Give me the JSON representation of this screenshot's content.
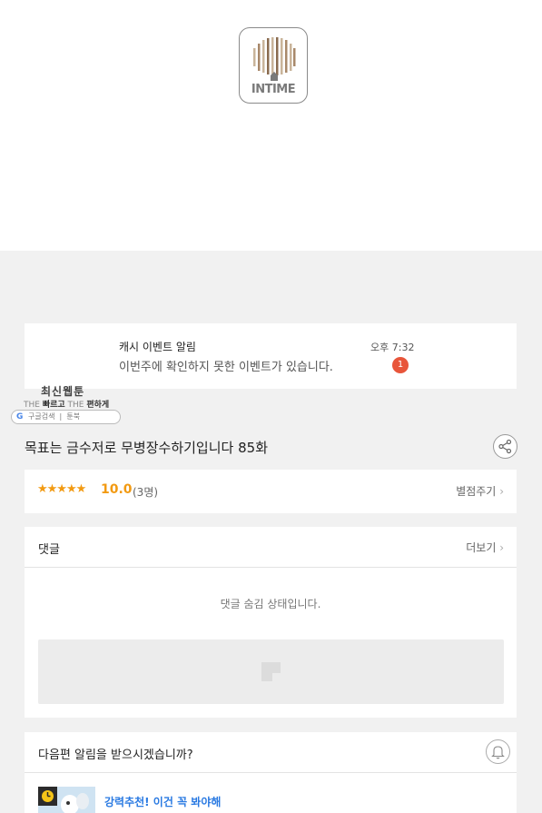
{
  "logo": {
    "text": "INTIME"
  },
  "notification": {
    "title": "캐시 이벤트 알림",
    "message": "이번주에 확인하지 못한 이벤트가 있습니다.",
    "time": "오후 7:32",
    "badge": "1",
    "badge_color": "#e8553a"
  },
  "watermark": {
    "title": "최신웹툰",
    "sub_prefix1": "THE",
    "sub_bold1": "빠르고",
    "sub_prefix2": "THE",
    "sub_bold2": "편하게",
    "google_g": "G",
    "search_label": "구글검색",
    "site": "툰북"
  },
  "episode": {
    "title": "목표는 금수저로 무병장수하기입니다 85화",
    "share_icon": "share-icon"
  },
  "rating": {
    "stars": "★★★★★",
    "score": "10.0",
    "count": "(3명)",
    "rate_button": "별점주기",
    "star_color": "#f29a12"
  },
  "comments": {
    "title": "댓글",
    "more": "더보기",
    "hidden_message": "댓글 숨김 상태입니다."
  },
  "next_episode": {
    "title": "다음편 알림을 받으시겠습니까?",
    "bell_icon": "bell-icon",
    "recommend": "강력추천! 이건 꼭 봐야해",
    "recommend_color": "#2a7ae2"
  }
}
